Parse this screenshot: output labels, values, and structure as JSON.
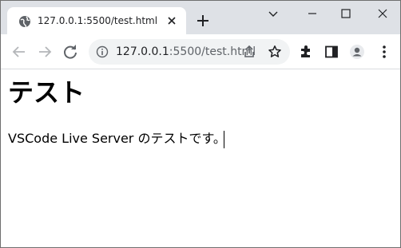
{
  "browser": {
    "tab": {
      "title": "127.0.0.1:5500/test.html",
      "favicon": "globe-icon",
      "close_icon": "close-icon"
    },
    "new_tab_icon": "plus-icon",
    "window_controls": [
      "chevron-down-icon",
      "minimize-icon",
      "maximize-icon",
      "close-icon"
    ],
    "toolbar": {
      "back_icon": "arrow-left-icon",
      "forward_icon": "arrow-right-icon",
      "reload_icon": "reload-icon",
      "address": {
        "host": "127.0.0.1",
        "rest": ":5500/test.html",
        "info_icon": "info-icon",
        "share_icon": "share-icon",
        "bookmark_icon": "star-icon"
      },
      "right_icons": [
        "puzzle-icon",
        "side-panel-icon",
        "profile-icon",
        "kebab-menu-icon"
      ]
    }
  },
  "page": {
    "heading": "テスト",
    "paragraph": "VSCode Live Server のテストです。"
  },
  "colors": {
    "tabstrip_bg": "#dee1e6",
    "omnibox_bg": "#f1f3f4",
    "icon": "#5f6368",
    "text": "#202124"
  }
}
